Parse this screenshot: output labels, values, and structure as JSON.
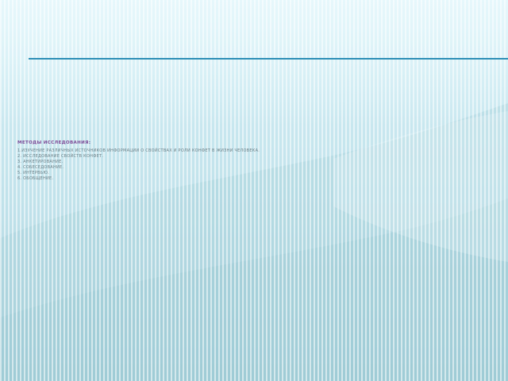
{
  "slide": {
    "heading": "МЕТОДЫ ИССЛЕДОВАНИЯ:",
    "items": [
      "1.ИЗУЧЕНИЕ РАЗЛИЧНЫХ ИСТОЧНИКОВ ИНФОРМАЦИИ О СВОЙСТВАХ И РОЛИ КОНФЕТ В ЖИЗНИ ЧЕЛОВЕКА.",
      "2. ИССЛЕДОВАНИЕ СВОЙСТВ КОНФЕТ.",
      "3. АНКЕТИРОВАНИЕ.",
      "4. СОБЕСЕДОВАНИЕ.",
      "5. ИНТЕРВЬЮ.",
      "6. ОБОБЩЕНИЕ."
    ]
  },
  "colors": {
    "heading": "#7d4b97",
    "rule": "#2f8fb7",
    "body_text": "#6b7f86"
  }
}
